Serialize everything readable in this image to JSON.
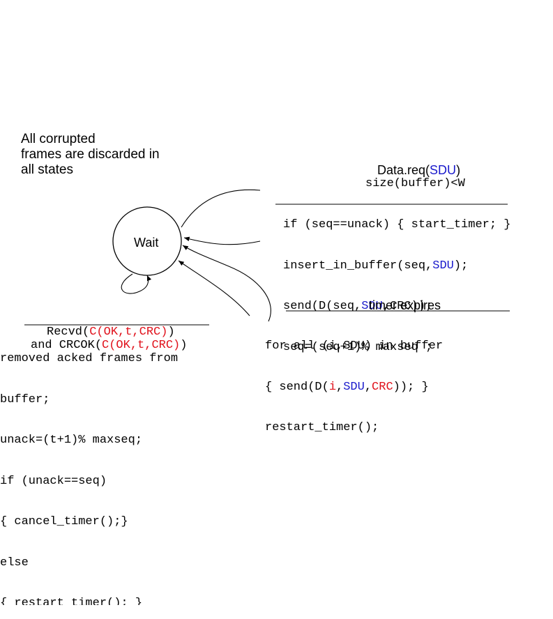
{
  "note": {
    "lines": [
      "All corrupted",
      "frames are discarded in",
      "all states"
    ]
  },
  "state": {
    "label": "Wait"
  },
  "data_req": {
    "event_prefix": "Data.req(",
    "event_arg": "SDU",
    "event_suffix": ")",
    "guard": "size(buffer)<W",
    "action1": "if (seq==unack) { start_timer; }",
    "action2_prefix": "insert_in_buffer(seq,",
    "action2_arg": "SDU",
    "action2_suffix": ");",
    "action3_prefix": "send(D(seq,",
    "action3_arg": "SDU",
    "action3_suffix": ",CRC));",
    "action4": "seq=(seq+1)% maxseq ;"
  },
  "timer": {
    "event": "timer expires",
    "action1": "for all (i,SDU) in buffer",
    "action2_prefix": "{ send(D(",
    "action2_i": "i",
    "action2_sep1": ",",
    "action2_sdu": "SDU",
    "action2_sep2": ",",
    "action2_crc": "CRC",
    "action2_suffix": ")); }",
    "action3": "restart_timer();"
  },
  "recvd": {
    "line1_prefix": "Recvd(",
    "line1_colored": "C(OK,t,CRC)",
    "line1_suffix": ")",
    "line2_prefix": "and CRCOK(",
    "line2_colored": "C(OK,t,CRC)",
    "line2_suffix": ")",
    "actions": [
      "removed acked frames from",
      "buffer;",
      "unack=(t+1)% maxseq;",
      "if (unack==seq)",
      "{ cancel_timer();}",
      "else",
      "{ restart_timer(); }"
    ]
  },
  "colors": {
    "red": "#e0111b",
    "blue": "#1a1acc"
  }
}
